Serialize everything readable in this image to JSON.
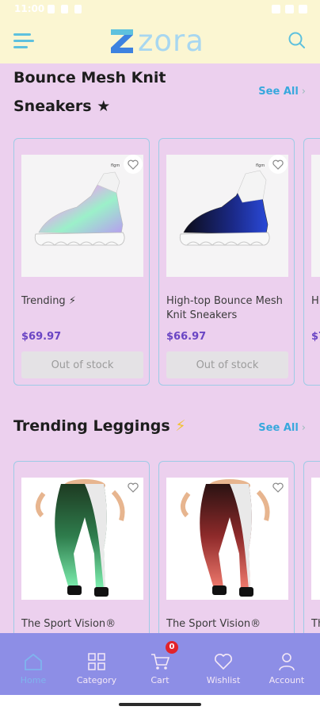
{
  "status_bar": {
    "time": "11:00"
  },
  "app": {
    "logo_text": "zora",
    "colors": {
      "header_bg": "#fbf6d2",
      "page_bg": "#ecd0ee",
      "accent": "#38a8dd",
      "price": "#6a45c4",
      "nav_bg": "#8d8ee6"
    }
  },
  "sections": [
    {
      "title_line1": "Bounce Mesh Knit",
      "title_line2": "Sneakers",
      "title_icon": "★",
      "see_all": "See All",
      "products": [
        {
          "name": "Trending ⚡",
          "price": "$69.97",
          "stock": "Out of stock",
          "brand_mark": "flgm"
        },
        {
          "name": "High-top Bounce Mesh Knit Sneakers",
          "price": "$66.97",
          "stock": "Out of stock",
          "brand_mark": "flgm"
        },
        {
          "name": "Hi Kr",
          "price": "$7"
        }
      ]
    },
    {
      "title": "Trending Leggings",
      "title_icon": "⚡",
      "see_all": "See All",
      "products": [
        {
          "name": "The Sport Vision®"
        },
        {
          "name": "The Sport Vision®"
        },
        {
          "name": "Th"
        }
      ]
    }
  ],
  "bottom_nav": {
    "items": [
      {
        "label": "Home",
        "icon": "home-icon"
      },
      {
        "label": "Category",
        "icon": "grid-icon"
      },
      {
        "label": "Cart",
        "icon": "cart-icon"
      },
      {
        "label": "Wishlist",
        "icon": "heart-icon"
      },
      {
        "label": "Account",
        "icon": "user-icon"
      }
    ],
    "cart_count": "0"
  }
}
